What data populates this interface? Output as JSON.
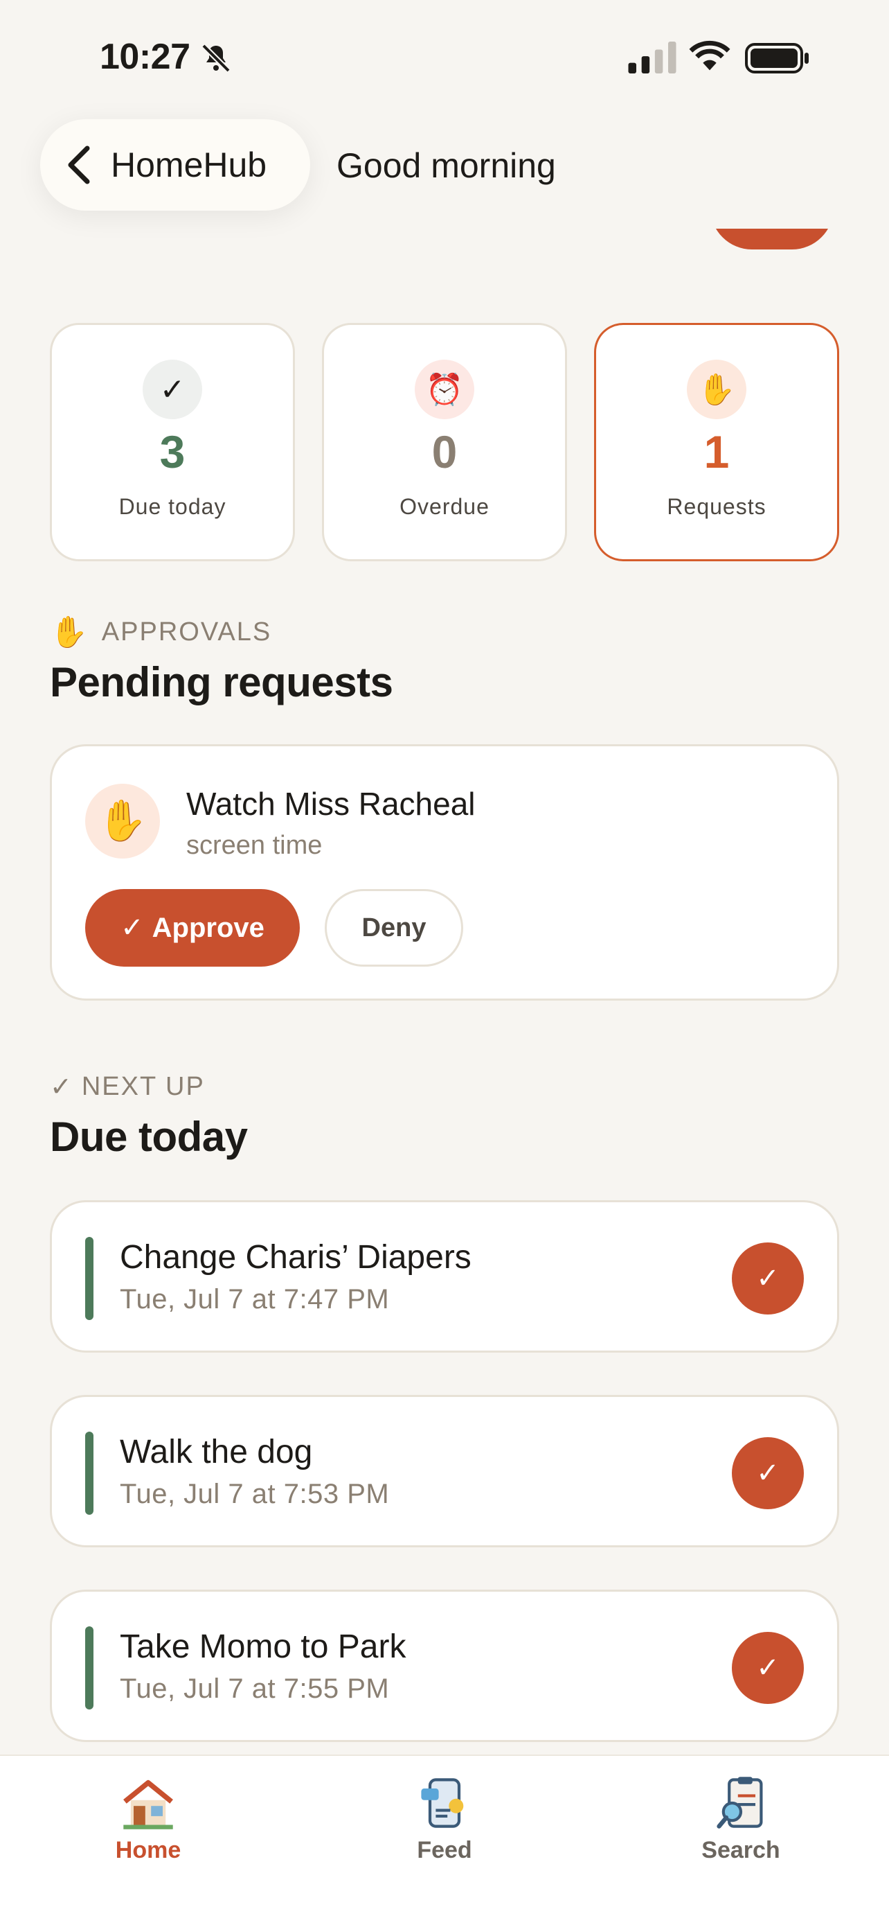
{
  "status_bar": {
    "time": "10:27"
  },
  "header": {
    "back_label": "HomeHub",
    "title": "Good morning"
  },
  "stats": [
    {
      "icon": "✓",
      "value": "3",
      "label": "Due today",
      "color": "#4d7a5a"
    },
    {
      "icon": "⏰",
      "value": "0",
      "label": "Overdue",
      "color": "#8a7f72"
    },
    {
      "icon": "✋",
      "value": "1",
      "label": "Requests",
      "color": "#d55d2c"
    }
  ],
  "approvals": {
    "eyebrow": "APPROVALS",
    "eyebrow_icon": "✋",
    "title": "Pending requests",
    "request": {
      "icon": "✋",
      "title": "Watch Miss Racheal",
      "subtitle": "screen time",
      "approve_label": "Approve",
      "approve_icon": "✓",
      "deny_label": "Deny"
    }
  },
  "next_up": {
    "eyebrow": "NEXT UP",
    "eyebrow_icon": "✓",
    "title": "Due today",
    "tasks": [
      {
        "title": "Change Charis’ Diapers",
        "time": "Tue, Jul 7 at 7:47 PM"
      },
      {
        "title": "Walk the dog",
        "time": "Tue, Jul 7 at 7:53 PM"
      },
      {
        "title": "Take Momo to Park",
        "time": "Tue, Jul 7 at 7:55 PM"
      }
    ],
    "check_icon": "✓"
  },
  "tabbar": {
    "tabs": [
      {
        "label": "Home",
        "icon": "house-icon",
        "active": true
      },
      {
        "label": "Feed",
        "icon": "feed-phone-icon",
        "active": false
      },
      {
        "label": "Search",
        "icon": "search-clipboard-icon",
        "active": false
      }
    ]
  },
  "colors": {
    "accent": "#c8502e",
    "green": "#4d7a5a",
    "background": "#f7f5f1"
  }
}
